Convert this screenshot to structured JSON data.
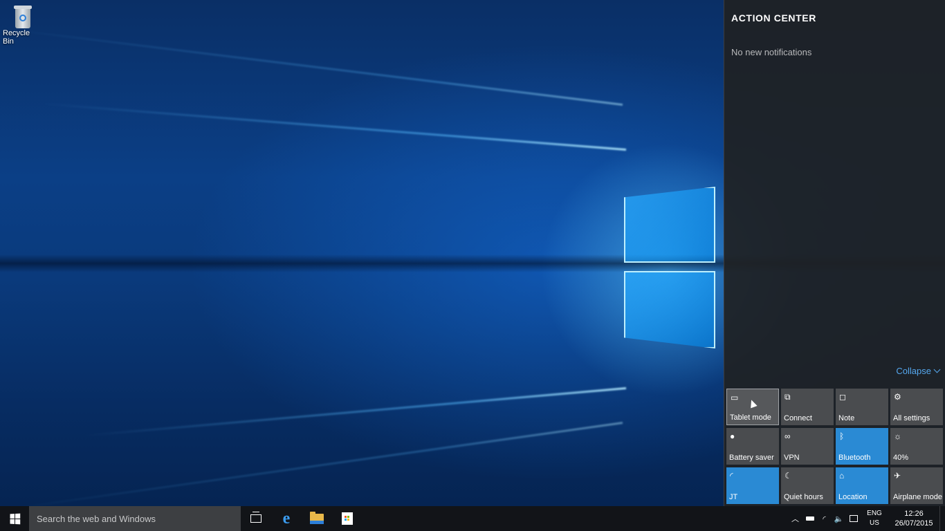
{
  "desktop": {
    "icons": [
      {
        "label": "Recycle Bin",
        "icon": "recycle-bin-icon"
      }
    ]
  },
  "action_center": {
    "title": "ACTION CENTER",
    "empty_message": "No new notifications",
    "collapse_label": "Collapse",
    "tiles": [
      {
        "label": "Tablet mode",
        "icon": "tablet-mode-icon",
        "state": "hover"
      },
      {
        "label": "Connect",
        "icon": "connect-icon",
        "state": "off"
      },
      {
        "label": "Note",
        "icon": "note-icon",
        "state": "off"
      },
      {
        "label": "All settings",
        "icon": "gear-icon",
        "state": "off"
      },
      {
        "label": "Battery saver",
        "icon": "battery-saver-icon",
        "state": "off"
      },
      {
        "label": "VPN",
        "icon": "vpn-icon",
        "state": "off"
      },
      {
        "label": "Bluetooth",
        "icon": "bluetooth-icon",
        "state": "on"
      },
      {
        "label": "40%",
        "icon": "brightness-icon",
        "state": "off"
      },
      {
        "label": "JT",
        "icon": "wifi-icon",
        "state": "on"
      },
      {
        "label": "Quiet hours",
        "icon": "moon-icon",
        "state": "off"
      },
      {
        "label": "Location",
        "icon": "location-icon",
        "state": "on"
      },
      {
        "label": "Airplane mode",
        "icon": "airplane-icon",
        "state": "off"
      }
    ],
    "colors": {
      "active_tile": "#2a8ad4",
      "inactive_tile": "#4a4c4f",
      "link": "#55a8ef"
    }
  },
  "taskbar": {
    "search_placeholder": "Search the web and Windows",
    "pinned": [
      {
        "name": "task-view",
        "icon": "task-view-icon"
      },
      {
        "name": "edge",
        "icon": "edge-icon"
      },
      {
        "name": "file-explorer",
        "icon": "folder-icon"
      },
      {
        "name": "store",
        "icon": "store-icon"
      }
    ],
    "tray": {
      "language_line1": "ENG",
      "language_line2": "US",
      "time": "12:26",
      "date": "26/07/2015"
    }
  }
}
